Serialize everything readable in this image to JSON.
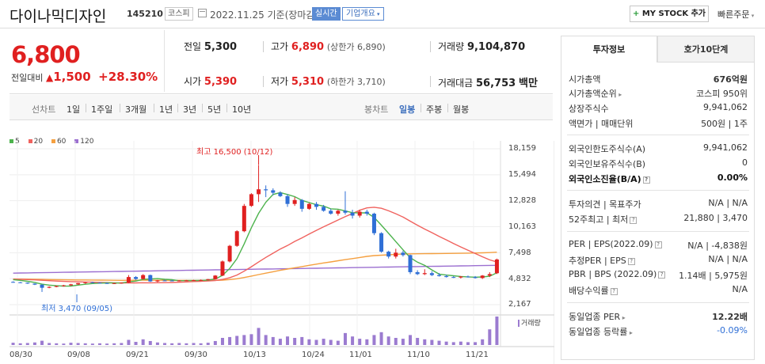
{
  "header": {
    "name": "다이나믹디자인",
    "code": "145210",
    "market": "코스피",
    "date": "2022.11.25 기준(장마감)",
    "realtime": "실시간",
    "company": "기업개요",
    "mystock": "MY STOCK 추가",
    "quick": "빠른주문"
  },
  "quote": {
    "price": "6,800",
    "change_label": "전일대비",
    "change": "1,500",
    "change_pct": "+28.30%",
    "prev_label": "전일",
    "prev": "5,300",
    "high_label": "고가",
    "high": "6,890",
    "upper_limit": "(상한가 6,890)",
    "volume_label": "거래량",
    "volume": "9,104,870",
    "open_label": "시가",
    "open": "5,390",
    "low_label": "저가",
    "low": "5,310",
    "lower_limit": "(하한가 3,710)",
    "amount_label": "거래대금",
    "amount": "56,753",
    "amount_unit": "백만"
  },
  "periods": {
    "line_label": "선차트",
    "line": [
      "1일",
      "1주일",
      "3개월",
      "1년",
      "3년",
      "5년",
      "10년"
    ],
    "candle_label": "봉차트",
    "candle": [
      "일봉",
      "주봉",
      "월봉"
    ],
    "selected": "일봉"
  },
  "chart_data": {
    "type": "candlestick",
    "legend": [
      "5",
      "20",
      "60",
      "120"
    ],
    "colors": {
      "ma5": "#4db34d",
      "ma20": "#f0625e",
      "ma60": "#f5a040",
      "ma120": "#9b6fd0",
      "up": "#e02020",
      "down": "#2f6fd6",
      "volume": "#9b7bd0"
    },
    "y_ticks": [
      "18,159",
      "15,494",
      "12,828",
      "10,163",
      "7,498",
      "4,832",
      "2,167"
    ],
    "ylim": [
      2167,
      18159
    ],
    "x_ticks": [
      "08/30",
      "09/08",
      "09/21",
      "09/30",
      "10/13",
      "10/24",
      "11/01",
      "11/10",
      "11/21"
    ],
    "max_label": "최고 16,500 (10/12)",
    "min_label": "최저 3,470 (09/05)",
    "volume_label": "거래량",
    "ohlc": [
      [
        4500,
        4560,
        4420,
        4460
      ],
      [
        4460,
        4500,
        4380,
        4420
      ],
      [
        4420,
        4440,
        4300,
        4330
      ],
      [
        4330,
        4350,
        4180,
        4220
      ],
      [
        4220,
        4250,
        3470,
        3900
      ],
      [
        3900,
        4050,
        3850,
        3990
      ],
      [
        3990,
        4120,
        3950,
        4080
      ],
      [
        4080,
        4200,
        4020,
        4150
      ],
      [
        4150,
        4300,
        4100,
        4250
      ],
      [
        4250,
        4400,
        4200,
        4380
      ],
      [
        4380,
        4500,
        4300,
        4460
      ],
      [
        4460,
        4520,
        4400,
        4420
      ],
      [
        4420,
        4470,
        4350,
        4380
      ],
      [
        4380,
        4420,
        4300,
        4340
      ],
      [
        4340,
        4400,
        4280,
        4370
      ],
      [
        4370,
        4450,
        4320,
        4420
      ],
      [
        4420,
        5200,
        4380,
        5000
      ],
      [
        5000,
        5100,
        4700,
        4800
      ],
      [
        4800,
        5300,
        4750,
        5200
      ],
      [
        5200,
        5250,
        4500,
        4550
      ],
      [
        4550,
        4700,
        4480,
        4650
      ],
      [
        4650,
        4720,
        4580,
        4640
      ],
      [
        4640,
        4700,
        4560,
        4600
      ],
      [
        4600,
        4680,
        4550,
        4640
      ],
      [
        4640,
        4700,
        4590,
        4660
      ],
      [
        4660,
        4720,
        4600,
        4680
      ],
      [
        4680,
        4750,
        4620,
        4700
      ],
      [
        4700,
        4800,
        4650,
        4780
      ],
      [
        4780,
        5200,
        4750,
        5150
      ],
      [
        5150,
        6700,
        5100,
        6600
      ],
      [
        6600,
        8300,
        6500,
        8200
      ],
      [
        8200,
        9800,
        8100,
        9700
      ],
      [
        9700,
        12500,
        9600,
        12300
      ],
      [
        12300,
        13600,
        12200,
        13500
      ],
      [
        13500,
        16500,
        12700,
        14000
      ],
      [
        14000,
        14400,
        13200,
        13900
      ],
      [
        13900,
        14100,
        13400,
        13650
      ],
      [
        13650,
        13800,
        13200,
        13300
      ],
      [
        13300,
        13500,
        12200,
        12500
      ],
      [
        12500,
        13200,
        12300,
        12900
      ],
      [
        12900,
        13000,
        11700,
        12000
      ],
      [
        12000,
        12600,
        11900,
        12500
      ],
      [
        12500,
        12700,
        11900,
        12200
      ],
      [
        12200,
        12400,
        11700,
        11800
      ],
      [
        11800,
        12000,
        11400,
        11500
      ],
      [
        11500,
        11900,
        11300,
        11800
      ],
      [
        11800,
        13800,
        11400,
        11600
      ],
      [
        11600,
        11900,
        11000,
        11300
      ],
      [
        11300,
        11900,
        11100,
        11700
      ],
      [
        11700,
        11900,
        11300,
        11500
      ],
      [
        11500,
        11600,
        9300,
        9500
      ],
      [
        9500,
        9600,
        7500,
        7600
      ],
      [
        7600,
        7700,
        6900,
        7100
      ],
      [
        7100,
        7900,
        6900,
        7500
      ],
      [
        7500,
        7700,
        7100,
        7250
      ],
      [
        7250,
        7300,
        5300,
        5500
      ],
      [
        5500,
        5700,
        5200,
        5300
      ],
      [
        5300,
        5800,
        5200,
        5400
      ],
      [
        5400,
        5600,
        5100,
        5200
      ],
      [
        5200,
        5400,
        5050,
        5100
      ],
      [
        5100,
        5250,
        4950,
        5000
      ],
      [
        5000,
        5100,
        4900,
        4950
      ],
      [
        4950,
        5100,
        4850,
        5050
      ],
      [
        5050,
        5150,
        4950,
        5000
      ],
      [
        5000,
        5100,
        4850,
        4900
      ],
      [
        4900,
        5200,
        4800,
        5150
      ],
      [
        5150,
        5500,
        5000,
        5300
      ],
      [
        5390,
        6890,
        5310,
        6800
      ]
    ],
    "volume": [
      0.08,
      0.06,
      0.07,
      0.09,
      0.15,
      0.07,
      0.06,
      0.05,
      0.08,
      0.07,
      0.06,
      0.05,
      0.06,
      0.05,
      0.06,
      0.07,
      0.18,
      0.11,
      0.2,
      0.14,
      0.09,
      0.07,
      0.06,
      0.07,
      0.06,
      0.07,
      0.06,
      0.08,
      0.14,
      0.25,
      0.28,
      0.32,
      0.35,
      0.38,
      0.6,
      0.35,
      0.28,
      0.22,
      0.3,
      0.25,
      0.28,
      0.2,
      0.18,
      0.22,
      0.18,
      0.15,
      0.42,
      0.3,
      0.22,
      0.2,
      0.35,
      0.45,
      0.3,
      0.25,
      0.22,
      0.35,
      0.25,
      0.2,
      0.18,
      0.15,
      0.12,
      0.1,
      0.12,
      0.1,
      0.1,
      0.2,
      0.55,
      1.0
    ]
  },
  "panel": {
    "tab1": "투자정보",
    "tab2": "호가10단계",
    "rows1": [
      {
        "label": "시가총액",
        "value": "676억원",
        "bold": true
      },
      {
        "label": "시가총액순위",
        "value": "코스피 950위"
      },
      {
        "label": "상장주식수",
        "value": "9,941,062"
      },
      {
        "label": "액면가 | 매매단위",
        "value": "500원 | 1주"
      }
    ],
    "rows2": [
      {
        "label": "외국인한도주식수(A)",
        "value": "9,941,062"
      },
      {
        "label": "외국인보유주식수(B)",
        "value": "0"
      },
      {
        "label": "외국인소진율(B/A)",
        "value": "0.00%",
        "bold": true
      }
    ],
    "rows3": [
      {
        "label": "투자의견 | 목표주가",
        "value": "N/A | N/A"
      },
      {
        "label": "52주최고 | 최저",
        "value": "21,880 | 3,470"
      }
    ],
    "rows4": [
      {
        "label": "PER | EPS(2022.09)",
        "value": "N/A | -4,838원"
      },
      {
        "label": "추정PER | EPS",
        "value": "N/A | N/A"
      },
      {
        "label": "PBR | BPS (2022.09)",
        "value": "1.14배 | 5,975원"
      },
      {
        "label": "배당수익률",
        "value": "N/A"
      }
    ],
    "rows5": [
      {
        "label": "동일업종 PER",
        "value": "12.22배",
        "bold": true
      },
      {
        "label": "동일업종 등락률",
        "value": "-0.09%"
      }
    ]
  }
}
